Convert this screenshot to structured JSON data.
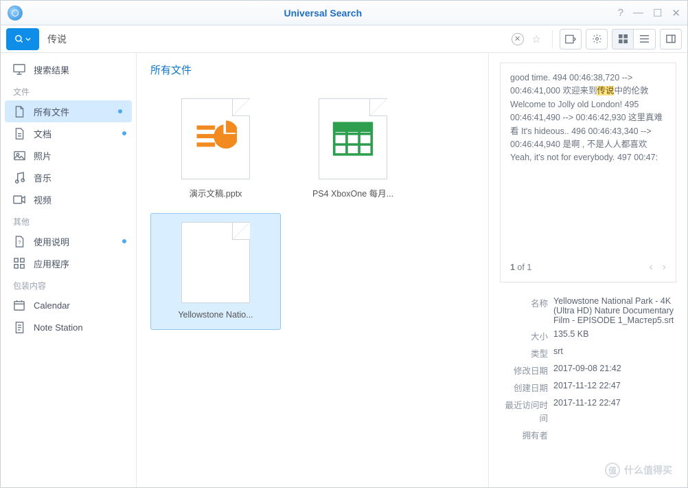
{
  "window": {
    "title": "Universal Search"
  },
  "search": {
    "value": "传说"
  },
  "sidebar": {
    "results_label": "搜索结果",
    "section_files": "文件",
    "items_files": [
      {
        "label": "所有文件",
        "active": true,
        "dot": true
      },
      {
        "label": "文档",
        "dot": true
      },
      {
        "label": "照片"
      },
      {
        "label": "音乐"
      },
      {
        "label": "视频"
      }
    ],
    "section_other": "其他",
    "items_other": [
      {
        "label": "使用说明",
        "dot": true
      },
      {
        "label": "应用程序"
      }
    ],
    "section_packages": "包装内容",
    "items_packages": [
      {
        "label": "Calendar"
      },
      {
        "label": "Note Station"
      }
    ]
  },
  "main": {
    "heading": "所有文件",
    "files": [
      {
        "label": "演示文稿.pptx",
        "type": "pptx"
      },
      {
        "label": "PS4 XboxOne 每月...",
        "type": "xlsx"
      },
      {
        "label": "Yellowstone Natio...",
        "type": "srt",
        "selected": true
      }
    ]
  },
  "preview": {
    "text_pre": "good time. 494 00:46:38,720 --> 00:46:41,000 欢迎来到",
    "text_hl": "传说",
    "text_post": "中的伦敦 Welcome to Jolly old London! 495 00:46:41,490 --> 00:46:42,930 这里真难看 It's hideous.. 496 00:46:43,340 --> 00:46:44,940 是啊 , 不是人人都喜欢 Yeah, it's not for everybody. 497 00:47:",
    "pager_current": "1",
    "pager_of": " of 1"
  },
  "meta": {
    "labels": {
      "name": "名称",
      "size": "大小",
      "type": "类型",
      "modified": "修改日期",
      "created": "创建日期",
      "accessed": "最近访问时间",
      "owner": "拥有者"
    },
    "values": {
      "name": "Yellowstone National Park - 4K (Ultra HD) Nature Documentary Film - EPISODE 1_Мастер5.srt",
      "size": "135.5 KB",
      "type": "srt",
      "modified": "2017-09-08 21:42",
      "created": "2017-11-12 22:47",
      "accessed": "2017-11-12 22:47",
      "owner": ""
    }
  },
  "watermark": "什么值得买"
}
